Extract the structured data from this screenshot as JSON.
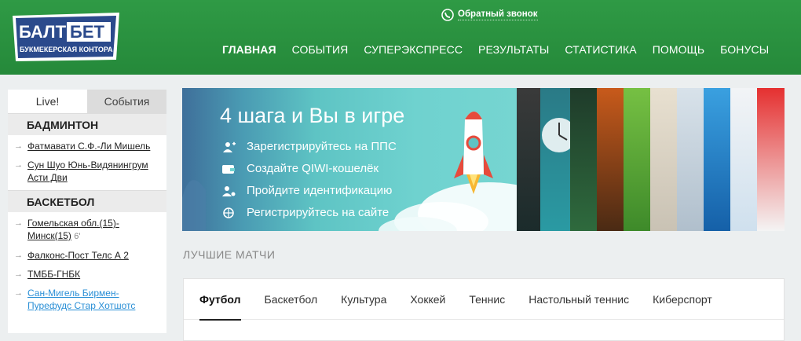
{
  "header": {
    "logo": {
      "line1_a": "БАЛТ",
      "line1_b": "БЕТ",
      "line2": "БУКМЕКЕРСКАЯ КОНТОРА"
    },
    "callback_label": "Обратный звонок",
    "nav": [
      "ГЛАВНАЯ",
      "СОБЫТИЯ",
      "СУПЕРЭКСПРЕСС",
      "РЕЗУЛЬТАТЫ",
      "СТАТИСТИКА",
      "ПОМОЩЬ",
      "БОНУСЫ"
    ]
  },
  "sidebar": {
    "tabs": [
      "Live!",
      "События"
    ],
    "groups": [
      {
        "sport": "БАДМИНТОН",
        "matches": [
          {
            "title": "Фатмавати С.Ф.-Ли Мишель",
            "score": ""
          },
          {
            "title": "Сун Шуо Юнь-Видянингрум Асти Дви",
            "score": ""
          }
        ]
      },
      {
        "sport": "БАСКЕТБОЛ",
        "matches": [
          {
            "title": "Гомельская обл.(15)-Минск(15)",
            "score": "6'"
          },
          {
            "title": "Фалконс-Пост Телс А 2",
            "score": ""
          },
          {
            "title": "ТМББ-ГНБК",
            "score": ""
          },
          {
            "title": "Сан-Мигель Бирмен-Пурефудс Стар Хотшотс",
            "score": ""
          }
        ]
      }
    ]
  },
  "banner": {
    "title": "4 шага и Вы в игре",
    "steps": [
      "Зарегистрируйтесь на ППС",
      "Создайте QIWI-кошелёк",
      "Пройдите идентификацию",
      "Регистрируйтесь на сайте"
    ]
  },
  "best_matches": {
    "heading": "ЛУЧШИЕ МАТЧИ",
    "tabs": [
      "Футбол",
      "Баскетбол",
      "Культура",
      "Хоккей",
      "Теннис",
      "Настольный теннис",
      "Киберспорт"
    ]
  },
  "colors": {
    "header_green": "#2f9a45",
    "logo_blue": "#2b4a8c",
    "link_blue": "#2a8fd6"
  }
}
